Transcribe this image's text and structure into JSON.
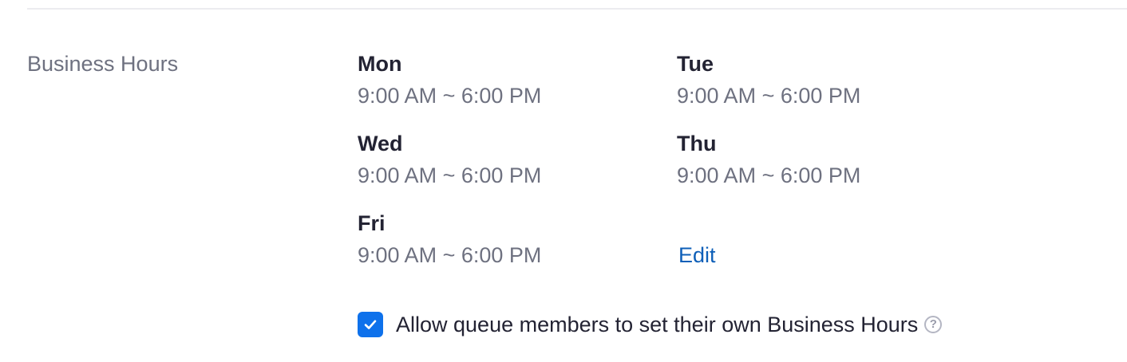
{
  "section": {
    "label": "Business Hours"
  },
  "schedule": [
    {
      "day": "Mon",
      "hours": "9:00 AM ~ 6:00 PM"
    },
    {
      "day": "Tue",
      "hours": "9:00 AM ~ 6:00 PM"
    },
    {
      "day": "Wed",
      "hours": "9:00 AM ~ 6:00 PM"
    },
    {
      "day": "Thu",
      "hours": "9:00 AM ~ 6:00 PM"
    },
    {
      "day": "Fri",
      "hours": "9:00 AM ~ 6:00 PM"
    }
  ],
  "actions": {
    "edit_label": "Edit"
  },
  "allow_member_hours": {
    "checked": true,
    "label": "Allow queue members to set their own Business Hours",
    "help_icon": "question-mark-icon",
    "help_glyph": "?"
  },
  "colors": {
    "accent": "#0e71eb",
    "link": "#0e5fb8",
    "primary_text": "#232333",
    "secondary_text": "#6e7180"
  }
}
